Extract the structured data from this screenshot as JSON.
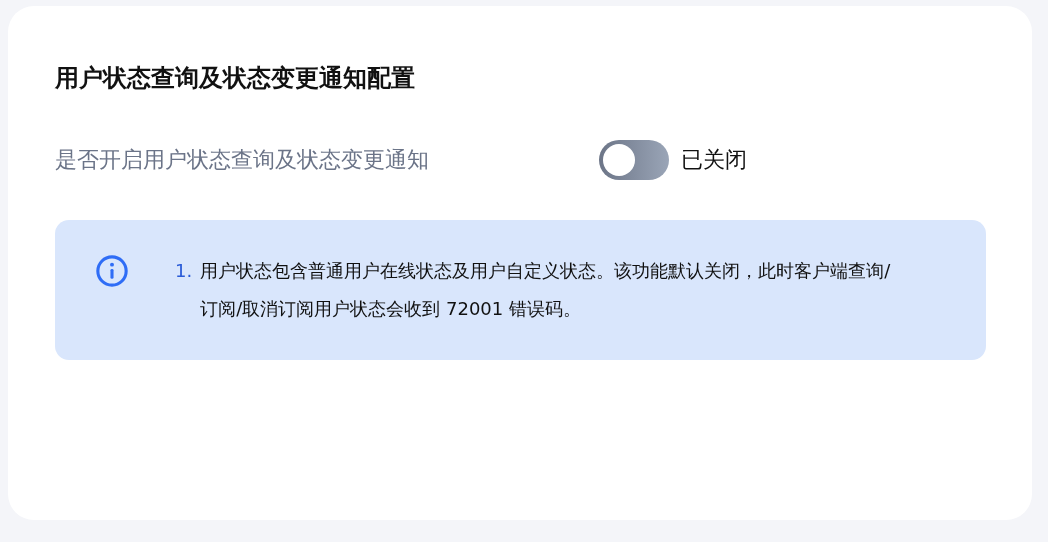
{
  "title": "用户状态查询及状态变更通知配置",
  "setting": {
    "label": "是否开启用户状态查询及状态变更通知",
    "on": false,
    "status": "已关闭"
  },
  "notice": {
    "items": [
      {
        "number": "1.",
        "text": "用户状态包含普通用户在线状态及用户自定义状态。该功能默认关闭，此时客户端查询/订阅/取消订阅用户状态会收到 72001 错误码。"
      }
    ]
  }
}
